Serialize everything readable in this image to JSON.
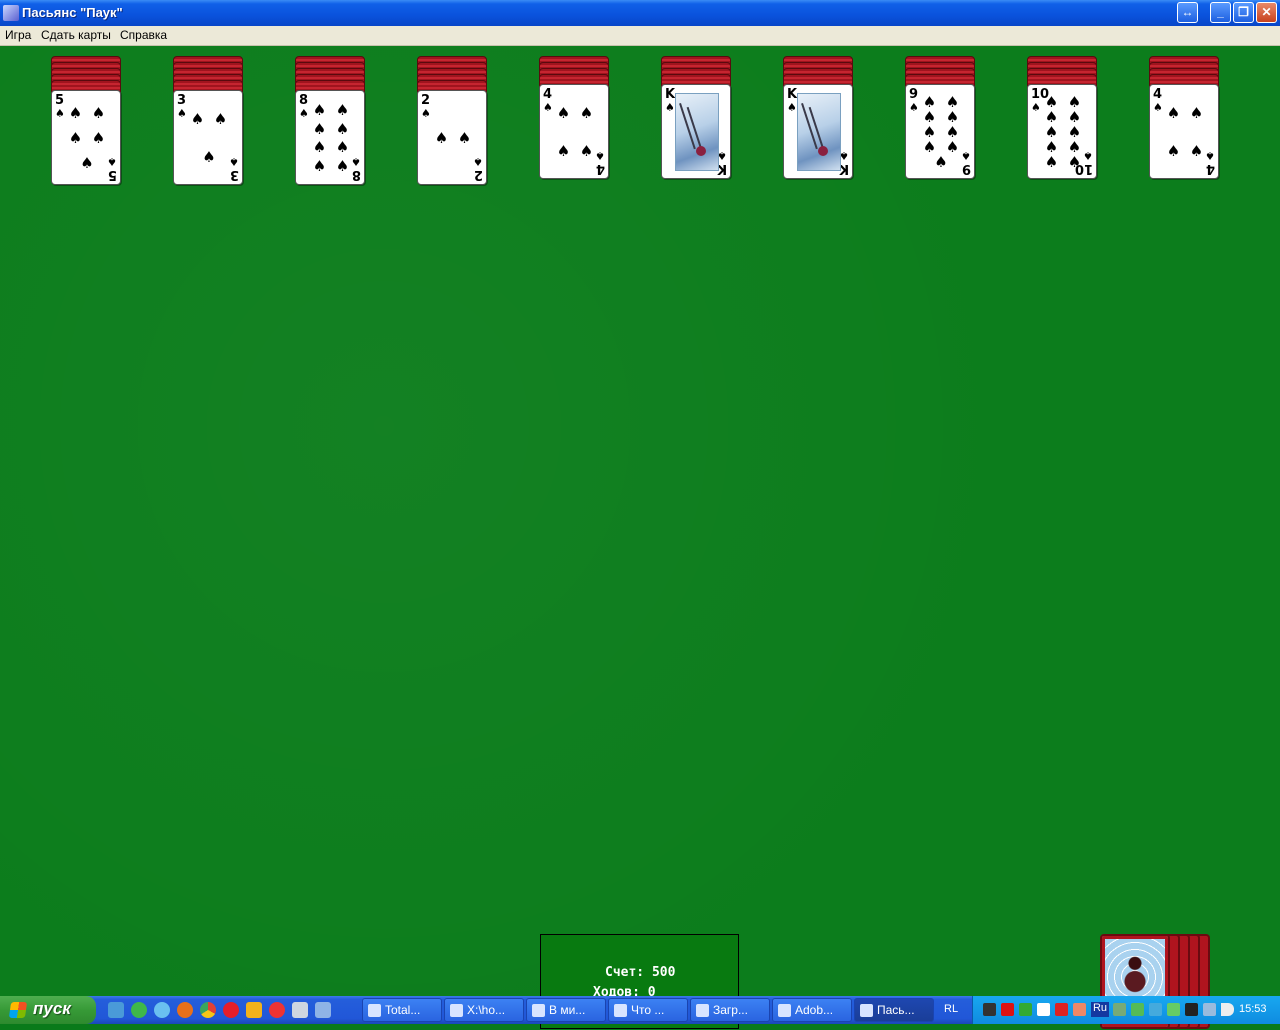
{
  "window": {
    "title": "Пасьянс \"Паук\"",
    "buttons": {
      "resize": "↔",
      "minimize": "_",
      "maximize": "❐",
      "close": "✕"
    }
  },
  "menu": {
    "items": [
      "Игра",
      "Сдать карты",
      "Справка"
    ]
  },
  "tableau": [
    {
      "rank": "5",
      "pips": 5,
      "hidden_count": 5
    },
    {
      "rank": "3",
      "pips": 3,
      "hidden_count": 5
    },
    {
      "rank": "8",
      "pips": 8,
      "hidden_count": 5
    },
    {
      "rank": "2",
      "pips": 2,
      "hidden_count": 5
    },
    {
      "rank": "4",
      "pips": 4,
      "hidden_count": 4
    },
    {
      "rank": "K",
      "pips": 0,
      "hidden_count": 4
    },
    {
      "rank": "K",
      "pips": 0,
      "hidden_count": 4
    },
    {
      "rank": "9",
      "pips": 9,
      "hidden_count": 4
    },
    {
      "rank": "10",
      "pips": 10,
      "hidden_count": 4
    },
    {
      "rank": "4",
      "pips": 4,
      "hidden_count": 4
    }
  ],
  "suit_symbol": "♠",
  "score": {
    "score_label": "Счет:",
    "score_value": "500",
    "moves_label": "Ходов:",
    "moves_value": "0"
  },
  "stock": {
    "piles": 5
  },
  "taskbar": {
    "start_label": "пуск",
    "tasks": [
      "Total...",
      "X:\\ho...",
      "В ми...",
      "Что ...",
      "Загр...",
      "Adob...",
      "Пась..."
    ],
    "active_task": 6,
    "language": "RL",
    "tray_language": "Ru",
    "clock": "15:53"
  },
  "colors": {
    "felt": "#0c7d1c",
    "card_back": "#b0141e",
    "title_bar": "#0a52dc",
    "taskbar": "#245edb",
    "start": "#379a37"
  }
}
